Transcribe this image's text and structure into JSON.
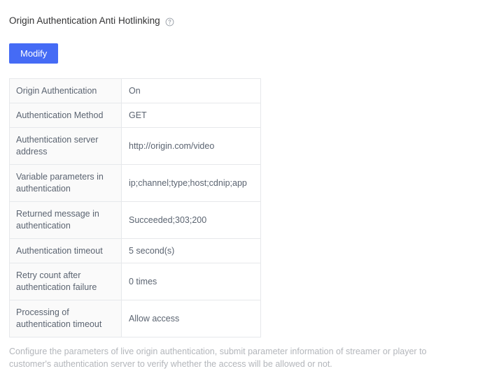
{
  "header": {
    "title": "Origin Authentication Anti Hotlinking",
    "help_icon": "help-circle-icon"
  },
  "toolbar": {
    "modify_label": "Modify"
  },
  "colors": {
    "primary_button": "#456bf5",
    "title_text": "#323233",
    "body_text": "#5b6471",
    "label_cell_bg": "#fafafa",
    "border": "#e6e8eb",
    "footer_text": "#b3b6bb"
  },
  "info_table": {
    "rows": [
      {
        "label": "Origin Authentication",
        "value": "On",
        "lines": 1
      },
      {
        "label": "Authentication Method",
        "value": "GET",
        "lines": 1
      },
      {
        "label": "Authentication server address",
        "value": "http://origin.com/video",
        "lines": 2
      },
      {
        "label": "Variable parameters in authentication",
        "value": "ip;channel;type;host;cdnip;app",
        "lines": 2
      },
      {
        "label": "Returned message in authentication",
        "value": "Succeeded;303;200",
        "lines": 2
      },
      {
        "label": "Authentication timeout",
        "value": "5 second(s)",
        "lines": 1
      },
      {
        "label": "Retry count after authentication failure",
        "value": "0 times",
        "lines": 2
      },
      {
        "label": "Processing of authentication timeout",
        "value": "Allow access",
        "lines": 2
      }
    ]
  },
  "footer": {
    "note": "Configure the parameters of live origin authentication, submit parameter information of streamer or player to customer's authentication server to verify whether the access will be allowed or not."
  }
}
